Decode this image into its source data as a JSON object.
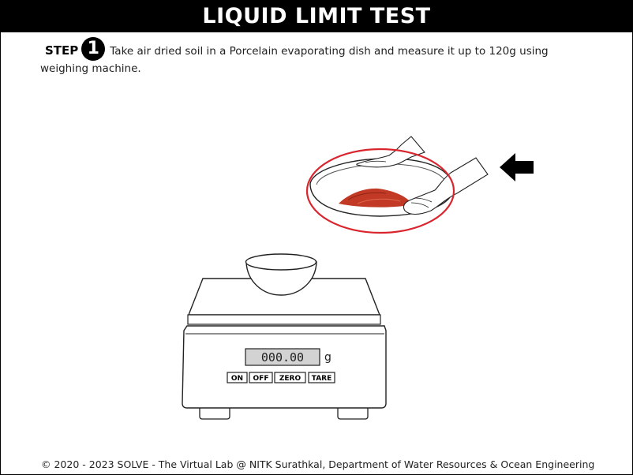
{
  "header": {
    "title": "LIQUID LIMIT TEST"
  },
  "step": {
    "label": "STEP",
    "number": "1",
    "instruction": "Take air dried soil in a Porcelain evaporating dish and measure it up to 120g using weighing machine."
  },
  "scale": {
    "reading": "000.00",
    "unit": "g",
    "buttons": {
      "on": "ON",
      "off": "OFF",
      "zero": "ZERO",
      "tare": "TARE"
    }
  },
  "highlight": {
    "circle_color": "#d9262e",
    "soil_color": "#c23a26"
  },
  "footer": {
    "text": "© 2020 - 2023 SOLVE - The Virtual Lab @ NITK Surathkal, Department of Water Resources & Ocean Engineering"
  }
}
